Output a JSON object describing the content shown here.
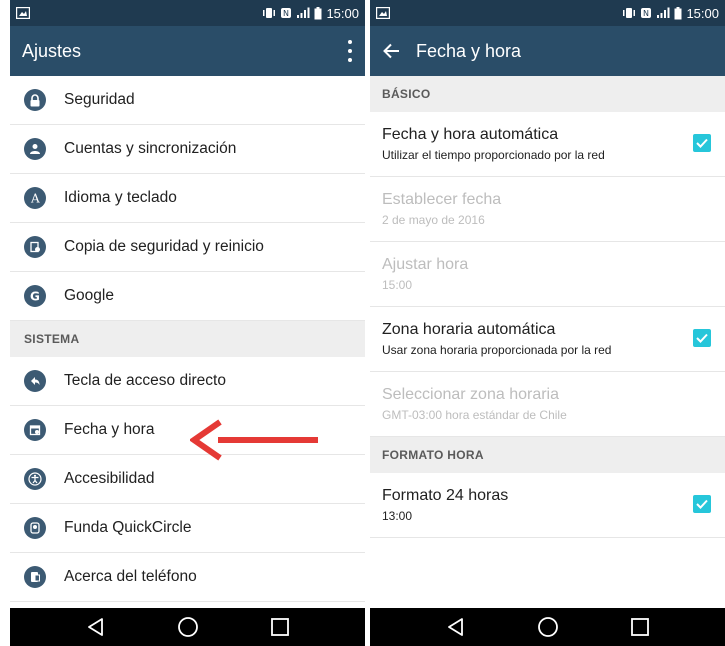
{
  "status": {
    "time": "15:00"
  },
  "left": {
    "title": "Ajustes",
    "items_top": [
      {
        "label": "Seguridad",
        "icon": "lock-icon"
      },
      {
        "label": "Cuentas y sincronización",
        "icon": "account-icon"
      },
      {
        "label": "Idioma y teclado",
        "icon": "language-icon"
      },
      {
        "label": "Copia de seguridad y reinicio",
        "icon": "backup-icon"
      },
      {
        "label": "Google",
        "icon": "google-icon"
      }
    ],
    "section_label": "SISTEMA",
    "items_system": [
      {
        "label": "Tecla de acceso directo",
        "icon": "shortcut-key-icon"
      },
      {
        "label": "Fecha y hora",
        "icon": "clock-calendar-icon"
      },
      {
        "label": "Accesibilidad",
        "icon": "accessibility-icon"
      },
      {
        "label": "Funda QuickCircle",
        "icon": "quickcircle-icon"
      },
      {
        "label": "Acerca del teléfono",
        "icon": "phone-info-icon"
      }
    ]
  },
  "right": {
    "title": "Fecha y hora",
    "section_basic": "BÁSICO",
    "auto_datetime": {
      "title": "Fecha y hora automática",
      "sub": "Utilizar el tiempo proporcionado por la red",
      "checked": true
    },
    "set_date": {
      "title": "Establecer fecha",
      "sub": "2 de mayo de 2016"
    },
    "set_time": {
      "title": "Ajustar hora",
      "sub": "15:00"
    },
    "auto_timezone": {
      "title": "Zona horaria automática",
      "sub": "Usar zona horaria proporcionada por la red",
      "checked": true
    },
    "select_timezone": {
      "title": "Seleccionar zona horaria",
      "sub": "GMT-03:00 hora estándar de Chile"
    },
    "section_format": "FORMATO HORA",
    "format24": {
      "title": "Formato 24 horas",
      "sub": "13:00",
      "checked": true
    }
  },
  "colors": {
    "statusbar": "#1f3a50",
    "appbar": "#2a4d68",
    "checkbox": "#26c6da",
    "arrow": "#e53935"
  }
}
